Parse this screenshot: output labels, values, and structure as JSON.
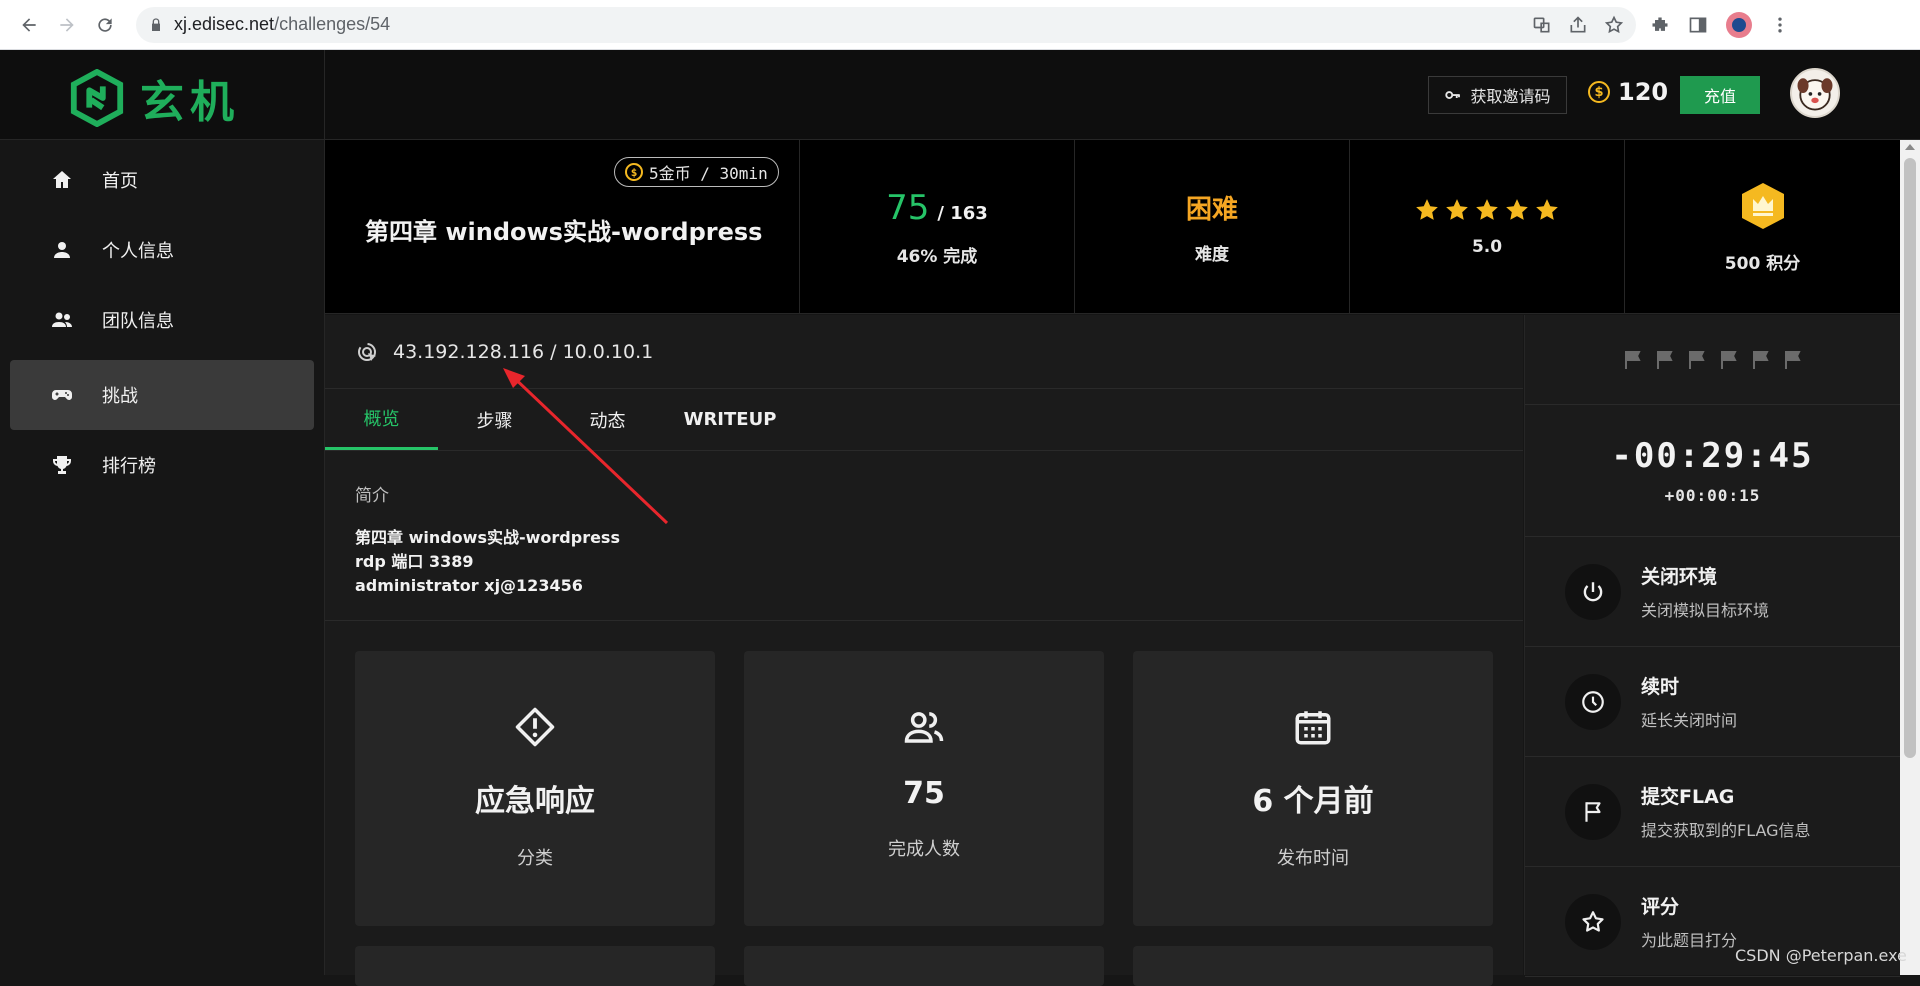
{
  "browser": {
    "url_host": "xj.edisec.net",
    "url_path": "/challenges/54"
  },
  "header": {
    "logo_text": "玄机",
    "invite_label": "获取邀请码",
    "coins": "120",
    "recharge_label": "充值"
  },
  "sidebar": {
    "items": [
      {
        "label": "首页",
        "icon": "home-icon"
      },
      {
        "label": "个人信息",
        "icon": "person-icon"
      },
      {
        "label": "团队信息",
        "icon": "group-icon"
      },
      {
        "label": "挑战",
        "icon": "gamepad-icon",
        "active": true
      },
      {
        "label": "排行榜",
        "icon": "trophy-icon"
      }
    ]
  },
  "challenge": {
    "cost": "5金币 / 30min",
    "title": "第四章 windows实战-wordpress",
    "solved": "75",
    "total": "/ 163",
    "progress_label": "46% 完成",
    "difficulty": "困难",
    "difficulty_label": "难度",
    "rating": "5.0",
    "rating_stars": 5,
    "points_label": "500 积分"
  },
  "main": {
    "ip": "43.192.128.116 / 10.0.10.1",
    "tabs": [
      "概览",
      "步骤",
      "动态",
      "WRITEUP"
    ],
    "intro_label": "简介",
    "intro_lines": [
      "第四章 windows实战-wordpress",
      "rdp 端口 3389",
      "administrator xj@123456"
    ],
    "cards": [
      {
        "icon": "diamond-alert-icon",
        "value": "应急响应",
        "label": "分类"
      },
      {
        "icon": "users-icon",
        "value": "75",
        "label": "完成人数"
      },
      {
        "icon": "calendar-icon",
        "value": "6 个月前",
        "label": "发布时间"
      }
    ]
  },
  "panel": {
    "flag_count": 6,
    "timer": "-00:29:45",
    "timer_extra": "+00:00:15",
    "actions": [
      {
        "icon": "power-icon",
        "title": "关闭环境",
        "desc": "关闭模拟目标环境"
      },
      {
        "icon": "clock-icon",
        "title": "续时",
        "desc": "延长关闭时间"
      },
      {
        "icon": "flag-icon",
        "title": "提交FLAG",
        "desc": "提交获取到的FLAG信息"
      },
      {
        "icon": "star-icon",
        "title": "评分",
        "desc": "为此题目打分"
      }
    ]
  },
  "watermark": "CSDN @Peterpan.exe",
  "colors": {
    "accent_green": "#26c468",
    "difficulty_orange": "#f5a623",
    "star_gold": "#f5b920"
  }
}
